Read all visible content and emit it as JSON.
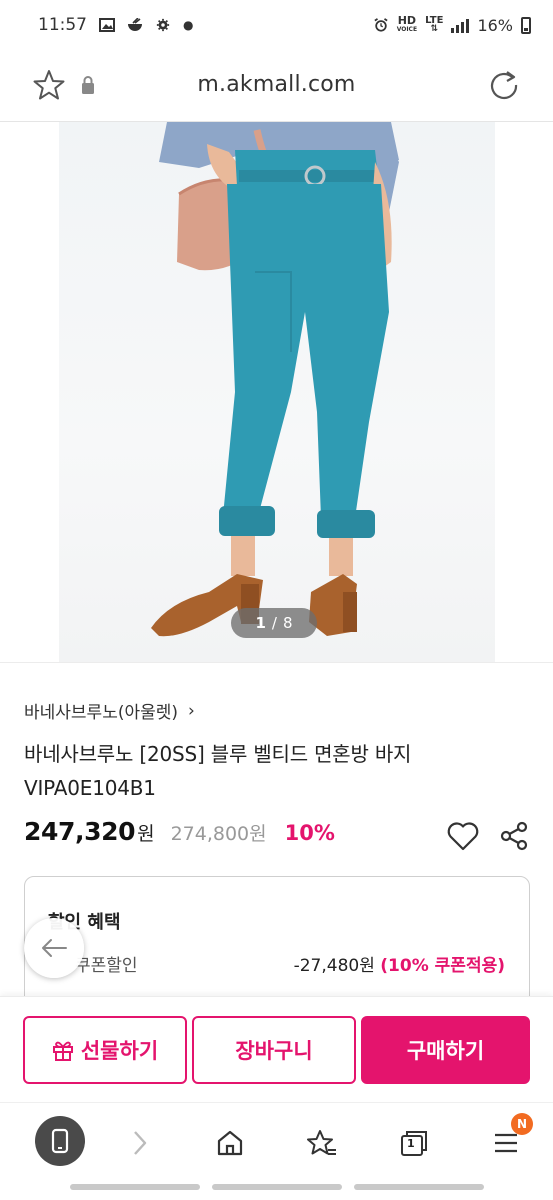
{
  "status_bar": {
    "time": "11:57",
    "battery": "16%",
    "network": "LTE",
    "hd": "HD",
    "hd_sub": "VOICE"
  },
  "url_bar": {
    "url": "m.akmall.com",
    "icons": [
      "star-icon",
      "lock-icon",
      "reload-icon"
    ]
  },
  "gallery": {
    "current": "1",
    "total": "8",
    "colors": {
      "pants": "#2f9bb3",
      "bag": "#d9a08a",
      "shirt": "#8ea6c8",
      "sandal": "#a9622d",
      "skin": "#e9b99a"
    }
  },
  "product": {
    "brand": "바네사브루노(아울렛)",
    "title": "바네사브루노 [20SS] 블루 벨티드 면혼방 바지 VIPA0E104B1",
    "sale_price": "247,320",
    "sale_unit": "원",
    "original_price": "274,800원",
    "discount_rate": "10%"
  },
  "discount": {
    "title": "할인 혜택",
    "coupon_label": "쿠폰할인",
    "coupon_amount": "-27,480원",
    "coupon_note": "(10% 쿠폰적용)"
  },
  "actions": {
    "gift": "선물하기",
    "cart": "장바구니",
    "buy": "구매하기",
    "accent": "#e4146d"
  },
  "browser_nav": {
    "tabs_count": "1",
    "menu_badge": "N",
    "badge_color": "#f26b21"
  }
}
